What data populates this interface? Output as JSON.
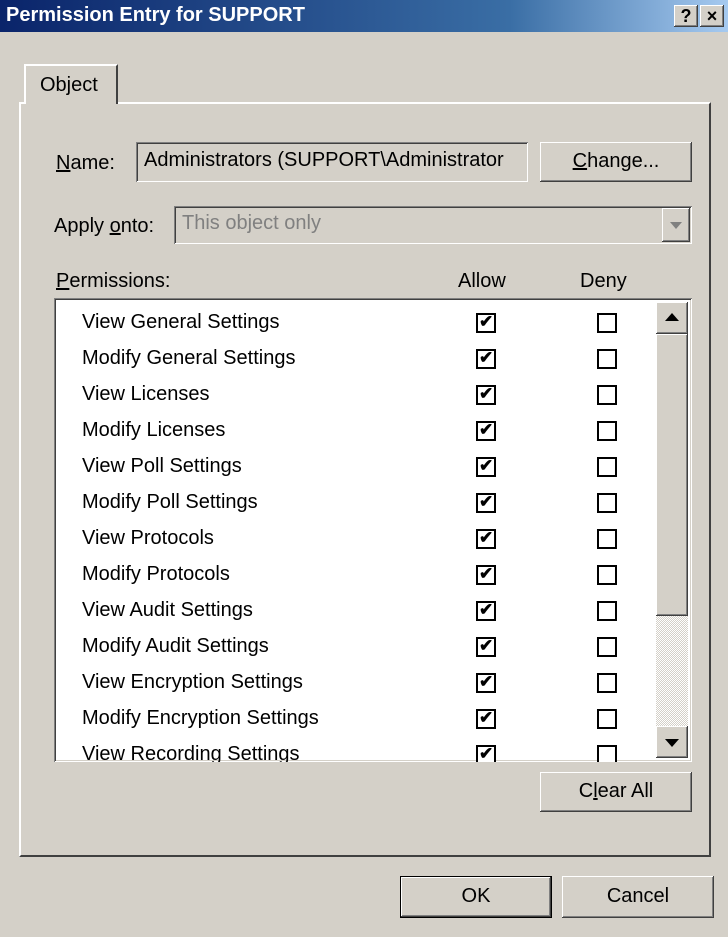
{
  "window": {
    "title": "Permission Entry for SUPPORT",
    "help_btn": "?",
    "close_btn": "×"
  },
  "tabs": [
    {
      "label": "Object",
      "active": true
    }
  ],
  "name_field": {
    "label": "Name:",
    "mnemonic": "N",
    "value": "Administrators (SUPPORT\\Administrator"
  },
  "change_button": {
    "label": "Change...",
    "mnemonic": "C"
  },
  "apply_onto": {
    "label": "Apply onto:",
    "value": "This object only",
    "enabled": false
  },
  "permissions": {
    "label": "Permissions:",
    "col_allow": "Allow",
    "col_deny": "Deny",
    "items": [
      {
        "name": "View General Settings",
        "allow": true,
        "deny": false
      },
      {
        "name": "Modify General Settings",
        "allow": true,
        "deny": false
      },
      {
        "name": "View Licenses",
        "allow": true,
        "deny": false
      },
      {
        "name": "Modify Licenses",
        "allow": true,
        "deny": false
      },
      {
        "name": "View Poll Settings",
        "allow": true,
        "deny": false
      },
      {
        "name": "Modify Poll Settings",
        "allow": true,
        "deny": false
      },
      {
        "name": "View Protocols",
        "allow": true,
        "deny": false
      },
      {
        "name": "Modify Protocols",
        "allow": true,
        "deny": false
      },
      {
        "name": "View Audit Settings",
        "allow": true,
        "deny": false
      },
      {
        "name": "Modify Audit Settings",
        "allow": true,
        "deny": false
      },
      {
        "name": "View Encryption Settings",
        "allow": true,
        "deny": false
      },
      {
        "name": "Modify Encryption Settings",
        "allow": true,
        "deny": false
      },
      {
        "name": "View Recording Settings",
        "allow": true,
        "deny": false
      }
    ]
  },
  "clear_all_button": {
    "label": "Clear All"
  },
  "ok_button": {
    "label": "OK"
  },
  "cancel_button": {
    "label": "Cancel"
  },
  "colors": {
    "title_start": "#0a246a",
    "title_end": "#a6caf0",
    "face": "#d4d0c8"
  }
}
